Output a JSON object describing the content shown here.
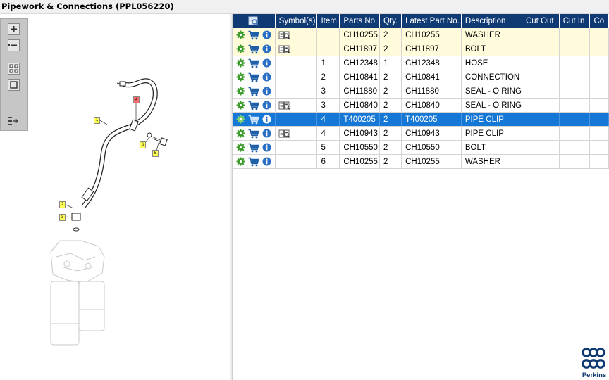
{
  "window": {
    "title": "Pipework & Connections (PPL056220)"
  },
  "diagram": {
    "callouts": [
      "1",
      "2",
      "3",
      "4",
      "5",
      "6"
    ]
  },
  "table": {
    "columns": [
      "Symbol(s)",
      "Item",
      "Parts No.",
      "Qty.",
      "Latest Part No.",
      "Description",
      "Cut Out",
      "Cut In",
      "Co"
    ],
    "rows": [
      {
        "symbol": true,
        "item": "",
        "parts_no": "CH10255",
        "qty": "2",
        "latest": "CH10255",
        "description": "WASHER",
        "cut_out": "",
        "cut_in": "",
        "co": "",
        "style": "yellow"
      },
      {
        "symbol": true,
        "item": "",
        "parts_no": "CH11897",
        "qty": "2",
        "latest": "CH11897",
        "description": "BOLT",
        "cut_out": "",
        "cut_in": "",
        "co": "",
        "style": "yellow"
      },
      {
        "symbol": false,
        "item": "1",
        "parts_no": "CH12348",
        "qty": "1",
        "latest": "CH12348",
        "description": "HOSE",
        "cut_out": "",
        "cut_in": "",
        "co": "",
        "style": "normal"
      },
      {
        "symbol": false,
        "item": "2",
        "parts_no": "CH10841",
        "qty": "2",
        "latest": "CH10841",
        "description": "CONNECTION",
        "cut_out": "",
        "cut_in": "",
        "co": "",
        "style": "normal"
      },
      {
        "symbol": false,
        "item": "3",
        "parts_no": "CH11880",
        "qty": "2",
        "latest": "CH11880",
        "description": "SEAL - O RING",
        "cut_out": "",
        "cut_in": "",
        "co": "",
        "style": "normal"
      },
      {
        "symbol": true,
        "item": "3",
        "parts_no": "CH10840",
        "qty": "2",
        "latest": "CH10840",
        "description": "SEAL - O RING",
        "cut_out": "",
        "cut_in": "",
        "co": "",
        "style": "normal"
      },
      {
        "symbol": false,
        "item": "4",
        "parts_no": "T400205",
        "qty": "2",
        "latest": "T400205",
        "description": "PIPE CLIP",
        "cut_out": "",
        "cut_in": "",
        "co": "",
        "style": "selected"
      },
      {
        "symbol": true,
        "item": "4",
        "parts_no": "CH10943",
        "qty": "2",
        "latest": "CH10943",
        "description": "PIPE CLIP",
        "cut_out": "",
        "cut_in": "",
        "co": "",
        "style": "normal"
      },
      {
        "symbol": false,
        "item": "5",
        "parts_no": "CH10550",
        "qty": "2",
        "latest": "CH10550",
        "description": "BOLT",
        "cut_out": "",
        "cut_in": "",
        "co": "",
        "style": "normal"
      },
      {
        "symbol": false,
        "item": "6",
        "parts_no": "CH10255",
        "qty": "2",
        "latest": "CH10255",
        "description": "WASHER",
        "cut_out": "",
        "cut_in": "",
        "co": "",
        "style": "normal"
      }
    ]
  },
  "brand": {
    "name": "Perkins"
  },
  "colors": {
    "header_bg": "#0f3a73",
    "selected_row": "#1577d6",
    "highlight_row": "#fffbdb",
    "gear_icon": "#3c9a2b",
    "cart_icon": "#1f5fa8",
    "info_icon": "#2a6fc2",
    "callout_yellow": "#ffff55",
    "callout_red": "#ff6b6b"
  },
  "icons": {
    "row_actions": [
      "gear-icon",
      "cart-icon",
      "info-icon"
    ],
    "symbol": "catalog-book-icon",
    "header": "search-table-icon",
    "toolbar": [
      "zoom-in-icon",
      "zoom-out-icon",
      "fit-page-icon",
      "actual-size-icon",
      "export-list-icon"
    ]
  }
}
